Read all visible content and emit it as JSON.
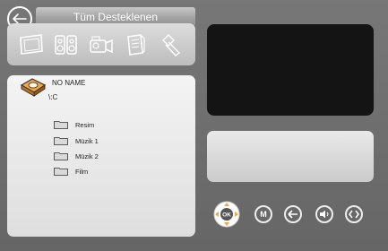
{
  "header": {
    "title": "Tüm Desteklenen"
  },
  "categories": [
    {
      "icon": "photo-frame-icon"
    },
    {
      "icon": "speakers-icon"
    },
    {
      "icon": "video-camera-icon"
    },
    {
      "icon": "document-icon"
    },
    {
      "icon": "usb-stick-icon"
    }
  ],
  "browser": {
    "drive_name": "NO NAME",
    "path": "\\:C",
    "folders": [
      {
        "name": "Resim"
      },
      {
        "name": "Müzik 1"
      },
      {
        "name": "Müzik 2"
      },
      {
        "name": "Film"
      }
    ]
  },
  "controls": {
    "ok_label": "OK",
    "menu_label": "M"
  },
  "colors": {
    "background": "#6e6e6e",
    "panel": "#e6e6e6",
    "preview": "#141414",
    "accent_orange": "#e89a3c"
  }
}
